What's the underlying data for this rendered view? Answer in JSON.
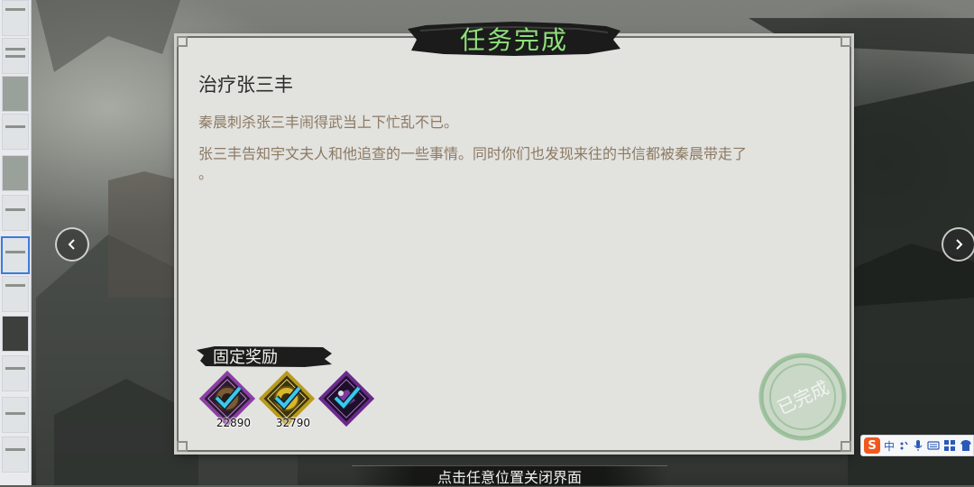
{
  "dialog": {
    "title": "任务完成",
    "quest_name": "治疗张三丰",
    "description_lines": [
      "秦晨刺杀张三丰闹得武当上下忙乱不已。",
      "张三丰告知宇文夫人和他追查的一些事情。同时你们也发现来往的书信都被秦晨带走了",
      "。"
    ],
    "rewards_title": "固定奖励",
    "rewards": [
      {
        "icon": "bronze-coin-icon",
        "count": "22890",
        "frame_color": "#8a3fa3"
      },
      {
        "icon": "gold-coin-icon",
        "count": "32790",
        "frame_color": "#b89a1e"
      },
      {
        "icon": "purple-item-icon",
        "count": "",
        "frame_color": "#6a2a8c"
      }
    ],
    "stamp_text": "已完成",
    "close_hint": "点击任意位置关闭界面"
  },
  "navigation": {
    "prev_icon": "chevron-left-icon",
    "next_icon": "chevron-right-icon"
  },
  "ime_toolbar": {
    "logo": "S",
    "mode": "中",
    "icons": [
      "punctuation-icon",
      "microphone-icon",
      "keyboard-icon",
      "toolbox-icon",
      "skin-icon"
    ]
  },
  "colors": {
    "title_green": "#8fe07a",
    "description_text": "#8c7a63",
    "panel_bg": "#e2e2df"
  }
}
